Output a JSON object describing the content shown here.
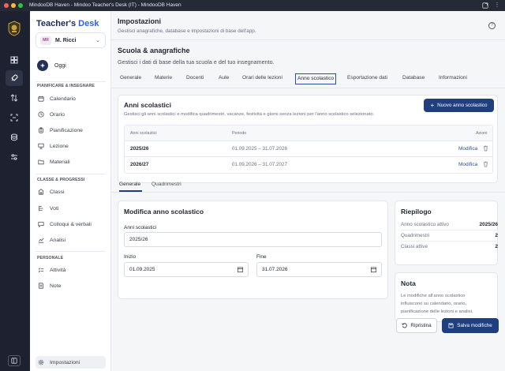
{
  "window": {
    "title": "MindooDB Haven - Mindoo Teacher's Desk (IT) - MindooDB Haven"
  },
  "brand": {
    "name": "Teacher's ",
    "accent": "Desk"
  },
  "user": {
    "initials": "MR",
    "name": "M. Ricci"
  },
  "sidebar": {
    "today": "Oggi",
    "sections": [
      {
        "title": "PIANIFICARE & INSEGNARE",
        "items": [
          "Calendario",
          "Orario",
          "Pianificazione",
          "Lezione",
          "Materiali"
        ]
      },
      {
        "title": "CLASSE & PROGRESSI",
        "items": [
          "Classi",
          "Voti",
          "Colloqui & verbali",
          "Analisi"
        ]
      },
      {
        "title": "PERSONALE",
        "items": [
          "Attività",
          "Note"
        ]
      }
    ],
    "settings": "Impostazioni"
  },
  "header": {
    "title": "Impostazioni",
    "subtitle": "Gestisci anagrafiche, database e impostazioni di base dell'app."
  },
  "section": {
    "title": "Scuola & anagrafiche",
    "subtitle": "Gestisci i dati di base della tua scuola e del tuo insegnamento."
  },
  "tabs": [
    "Generale",
    "Materie",
    "Docenti",
    "Aule",
    "Orari delle lezioni",
    "Anno scolastico",
    "Esportazione dati",
    "Database",
    "Informazioni"
  ],
  "years_card": {
    "title": "Anni scolastici",
    "subtitle": "Gestisci gli anni scolastici e modifica quadrimestri, vacanze, festività e giorni senza lezioni per l'anno scolastico selezionato.",
    "new_button": "Nuovo anno scolastico",
    "columns": {
      "year": "Anni scolastici",
      "period": "Periodo",
      "actions": "Azioni"
    },
    "rows": [
      {
        "year": "2025/26",
        "period": "01.09.2025 – 31.07.2026",
        "edit": "Modifica"
      },
      {
        "year": "2026/27",
        "period": "01.09.2026 – 31.07.2027",
        "edit": "Modifica"
      }
    ]
  },
  "subtabs": [
    "Generale",
    "Quadrimestri"
  ],
  "edit_card": {
    "title": "Modifica anno scolastico",
    "name_label": "Anni scolastici",
    "name_value": "2025/26",
    "start_label": "Inizio",
    "start_value": "01.09.2025",
    "end_label": "Fine",
    "end_value": "31.07.2026"
  },
  "summary": {
    "title": "Riepilogo",
    "rows": [
      {
        "k": "Anno scolastico attivo",
        "v": "2025/26"
      },
      {
        "k": "Quadrimestri",
        "v": "2"
      },
      {
        "k": "Classi attive",
        "v": "2"
      }
    ]
  },
  "note": {
    "title": "Nota",
    "lines": [
      "Le modifiche all'anno scolastico",
      "influiscono su calendario, orario,",
      "pianificazione delle lezioni e analisi."
    ]
  },
  "actions": {
    "reset": "Ripristina",
    "save": "Salva modifiche"
  },
  "colors": {
    "primary": "#1f3f80",
    "rail": "#1d2130",
    "link": "#2b4f9b"
  }
}
